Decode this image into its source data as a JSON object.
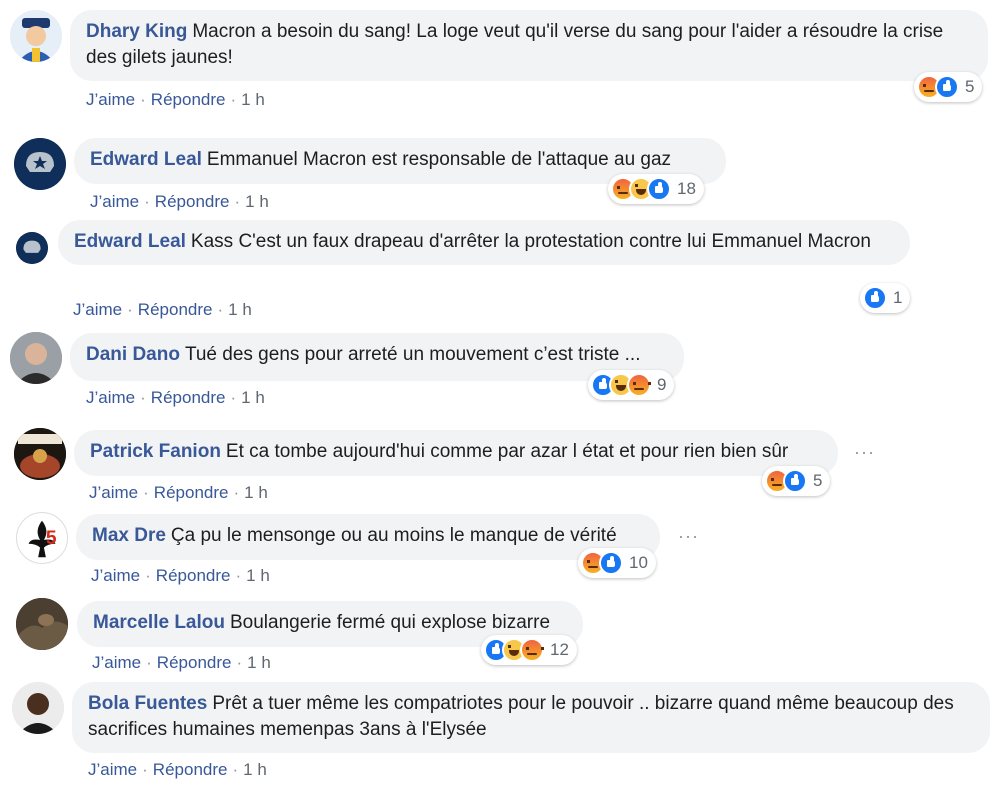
{
  "actions": {
    "like": "J’aime",
    "reply": "Répondre",
    "sep": "·",
    "time": "1 h"
  },
  "more_label": "···",
  "comments": [
    {
      "author": "Dhary King",
      "text": "Macron a besoin du sang! La loge veut qu'il verse du sang pour l'aider a résoudre la crise des gilets jaunes!",
      "reactions": [
        "angry",
        "like"
      ],
      "count": "5"
    },
    {
      "author": "Edward Leal",
      "text": "Emmanuel Macron est responsable de l'attaque au gaz",
      "reactions": [
        "angry",
        "haha",
        "like"
      ],
      "count": "18"
    },
    {
      "author": "Edward Leal",
      "text": "Kass C'est un faux drapeau d'arrêter la protestation contre lui Emmanuel Macron",
      "reactions": [
        "like"
      ],
      "count": "1"
    },
    {
      "author": "Dani Dano",
      "text": "Tué des gens pour arreté un mouvement c’est triste ...",
      "reactions": [
        "like",
        "haha",
        "angry"
      ],
      "count": "9"
    },
    {
      "author": "Patrick Fanion",
      "text": "Et ca tombe aujourd'hui comme par azar l état et pour rien bien sûr",
      "reactions": [
        "angry",
        "like"
      ],
      "count": "5"
    },
    {
      "author": "Max Dre",
      "text": "Ça pu le mensonge ou au moins le manque de vérité",
      "reactions": [
        "angry",
        "like"
      ],
      "count": "10"
    },
    {
      "author": "Marcelle Lalou",
      "text": "Boulangerie fermé qui explose bizarre",
      "reactions": [
        "like",
        "haha",
        "angry"
      ],
      "count": "12"
    },
    {
      "author": "Bola Fuentes",
      "text": "Prêt a tuer même les compatriotes pour le pouvoir .. bizarre quand même beaucoup des sacrifices humaines memenpas 3ans à l'Elysée",
      "reactions": [],
      "count": ""
    }
  ],
  "colors": {
    "author": "#385898",
    "bubble": "#f2f3f5",
    "like": "#1877f2"
  }
}
